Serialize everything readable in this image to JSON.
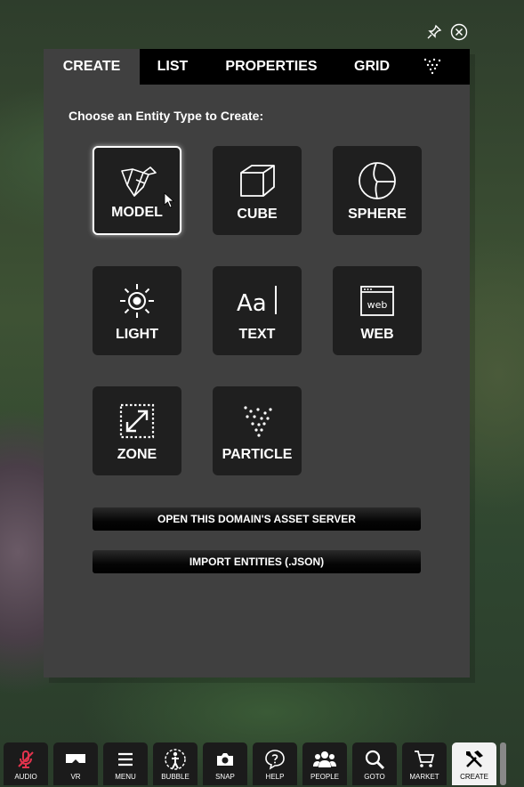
{
  "tabs": [
    {
      "label": "CREATE"
    },
    {
      "label": "LIST"
    },
    {
      "label": "PROPERTIES"
    },
    {
      "label": "GRID"
    }
  ],
  "prompt": "Choose an Entity Type to Create:",
  "entities": [
    {
      "label": "MODEL"
    },
    {
      "label": "CUBE"
    },
    {
      "label": "SPHERE"
    },
    {
      "label": "LIGHT"
    },
    {
      "label": "TEXT"
    },
    {
      "label": "WEB"
    },
    {
      "label": "ZONE"
    },
    {
      "label": "PARTICLE"
    }
  ],
  "icon_text": {
    "text": "Aa",
    "web": "web"
  },
  "buttons": {
    "asset_server": "OPEN THIS DOMAIN'S ASSET SERVER",
    "import": "IMPORT ENTITIES (.JSON)"
  },
  "toolbar": [
    {
      "label": "AUDIO"
    },
    {
      "label": "VR"
    },
    {
      "label": "MENU"
    },
    {
      "label": "BUBBLE"
    },
    {
      "label": "SNAP"
    },
    {
      "label": "HELP"
    },
    {
      "label": "PEOPLE"
    },
    {
      "label": "GOTO"
    },
    {
      "label": "MARKET"
    },
    {
      "label": "CREATE"
    }
  ],
  "colors": {
    "audio_muted": "#e2334d",
    "panel": "#404040",
    "tab_bar": "#000000"
  }
}
